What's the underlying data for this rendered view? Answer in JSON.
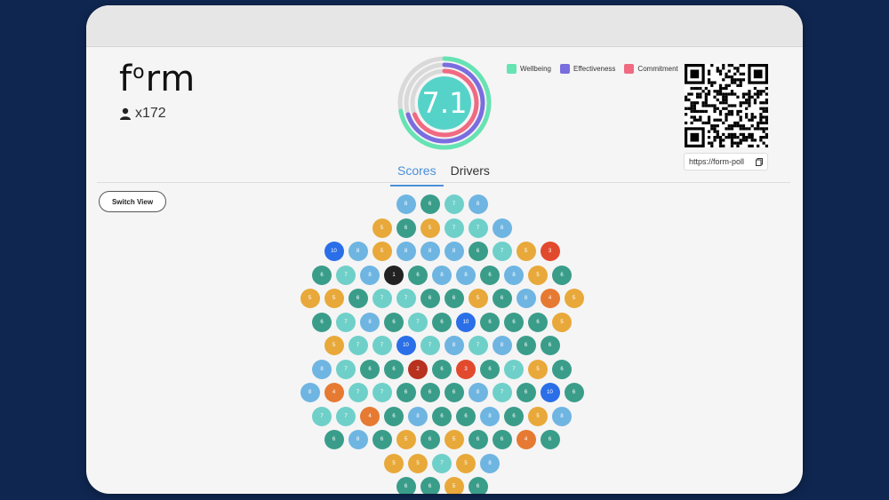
{
  "app": {
    "logo_text": "form",
    "participants": "x172"
  },
  "score": {
    "value": "7.1",
    "rings": [
      {
        "name": "Wellbeing",
        "color": "#66e3b3",
        "fraction": 0.72
      },
      {
        "name": "Effectiveness",
        "color": "#7a6de0",
        "fraction": 0.7
      },
      {
        "name": "Commitment",
        "color": "#f06a82",
        "fraction": 0.69
      }
    ]
  },
  "legend": [
    {
      "label": "Wellbeing",
      "color": "#66e3b3"
    },
    {
      "label": "Effectiveness",
      "color": "#7a6de0"
    },
    {
      "label": "Commitment",
      "color": "#f06a82"
    }
  ],
  "qr": {
    "url": "https://form-poll",
    "copy_icon": "copy-icon"
  },
  "tabs": [
    {
      "label": "Scores",
      "active": true
    },
    {
      "label": "Drivers",
      "active": false
    }
  ],
  "switch_view_label": "Switch View",
  "score_colors": {
    "1": "#222222",
    "2": "#b83220",
    "3": "#e24a2e",
    "4": "#e67a32",
    "5": "#e8a93a",
    "6": "#3a9d8a",
    "7": "#6fd0c9",
    "8": "#6fb5e2",
    "10": "#2a6fe8"
  },
  "score_rows": [
    [
      "8",
      "6",
      "7",
      "8"
    ],
    [
      "5",
      "6",
      "5",
      "7",
      "7",
      "8"
    ],
    [
      "10",
      "8",
      "5",
      "8",
      "8",
      "8",
      "6",
      "7",
      "5",
      "3"
    ],
    [
      "6",
      "7",
      "8",
      "1",
      "6",
      "8",
      "8",
      "6",
      "8",
      "5",
      "6"
    ],
    [
      "5",
      "5",
      "6",
      "7",
      "7",
      "6",
      "6",
      "5",
      "6",
      "8",
      "4",
      "5"
    ],
    [
      "6",
      "7",
      "8",
      "6",
      "7",
      "6",
      "10",
      "6",
      "6",
      "6",
      "5"
    ],
    [
      "5",
      "7",
      "7",
      "10",
      "7",
      "8",
      "7",
      "8",
      "6",
      "6"
    ],
    [
      "8",
      "7",
      "6",
      "6",
      "2",
      "6",
      "3",
      "6",
      "7",
      "5",
      "6"
    ],
    [
      "8",
      "4",
      "7",
      "7",
      "6",
      "6",
      "6",
      "8",
      "7",
      "6",
      "10",
      "6"
    ],
    [
      "7",
      "7",
      "4",
      "6",
      "8",
      "6",
      "6",
      "8",
      "6",
      "5",
      "8"
    ],
    [
      "6",
      "8",
      "6",
      "5",
      "6",
      "5",
      "6",
      "6",
      "4",
      "6"
    ],
    [
      "5",
      "5",
      "7",
      "5",
      "8"
    ],
    [
      "6",
      "6",
      "5",
      "6"
    ]
  ]
}
